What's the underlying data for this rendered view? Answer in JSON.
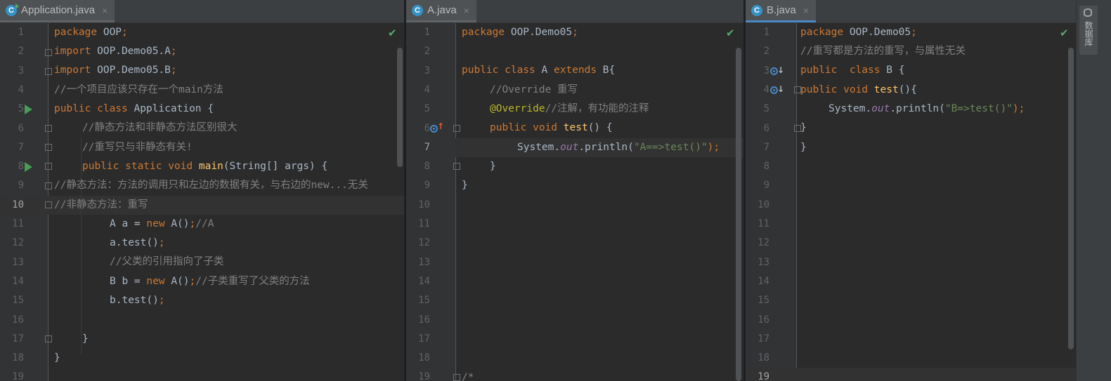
{
  "tabs": {
    "app": {
      "label": "Application.java",
      "close": "×"
    },
    "a": {
      "label": "A.java",
      "close": "×"
    },
    "b": {
      "label": "B.java",
      "close": "×"
    }
  },
  "file_icon_letter": "C",
  "right_strip": {
    "label": "数据库"
  },
  "status_check": "✔",
  "panes": {
    "app": {
      "line_numbers": [
        "1",
        "2",
        "3",
        "4",
        "5",
        "6",
        "7",
        "8",
        "9",
        "10",
        "11",
        "12",
        "13",
        "14",
        "15",
        "16",
        "17",
        "18",
        "19"
      ],
      "current_line": "10"
    },
    "a": {
      "line_numbers": [
        "1",
        "2",
        "3",
        "4",
        "5",
        "6",
        "7",
        "8",
        "9",
        "10",
        "11",
        "12",
        "13",
        "14",
        "15",
        "16",
        "17",
        "18",
        "19"
      ],
      "current_line": "7"
    },
    "b": {
      "line_numbers": [
        "1",
        "2",
        "3",
        "4",
        "5",
        "6",
        "7",
        "8",
        "9",
        "10",
        "11",
        "12",
        "13",
        "14",
        "15",
        "16",
        "17",
        "18",
        "19"
      ],
      "current_line": "19"
    }
  },
  "code_app": {
    "l1": {
      "kw": "package",
      "rest": " OOP",
      "semi": ";"
    },
    "l2": {
      "kw": "import",
      "rest": " OOP.Demo05.A",
      "semi": ";"
    },
    "l3": {
      "kw": "import",
      "rest": " OOP.Demo05.B",
      "semi": ";"
    },
    "l4": {
      "comment": "//一个项目应该只存在一个main方法"
    },
    "l5": {
      "kw": "public class",
      "rest": " Application {"
    },
    "l6": {
      "comment": "//静态方法和非静态方法区别很大"
    },
    "l7": {
      "comment": "//重写只与非静态有关!"
    },
    "l8": {
      "kw": "public static void",
      "fn": "main",
      "rest": "(String[] args) {"
    },
    "l9": {
      "comment": "//静态方法：方法的调用只和左边的数据有关，与右边的new...无关"
    },
    "l10": {
      "comment": "//非静态方法：重写"
    },
    "l11": {
      "pre": "A a = ",
      "kw": "new",
      "mid": " A()",
      "semi": ";",
      "comment": "//A"
    },
    "l12": {
      "pre": "a.test()",
      "semi": ";"
    },
    "l13": {
      "comment": "//父类的引用指向了子类"
    },
    "l14": {
      "pre": "B b = ",
      "kw": "new",
      "mid": " A()",
      "semi": ";",
      "comment": "//子类重写了父类的方法"
    },
    "l15": {
      "pre": "b.test()",
      "semi": ";"
    },
    "l17": {
      "rest": "}"
    },
    "l18": {
      "rest": "}"
    }
  },
  "code_a": {
    "l1": {
      "kw": "package",
      "rest": " OOP.Demo05",
      "semi": ";"
    },
    "l3": {
      "kw": "public class",
      "rest1": " A ",
      "kw2": "extends",
      "rest2": " B{"
    },
    "l4": {
      "comment": "//Override 重写"
    },
    "l5": {
      "ann": "@Override",
      "comment": "//注解，有功能的注释"
    },
    "l6": {
      "kw": "public void",
      "fn": "test",
      "rest": "() {"
    },
    "l7": {
      "pre": "System.",
      "static": "out",
      "mid": ".println(",
      "str": "\"A==>test()\"",
      "post": ");"
    },
    "l8": {
      "rest": "}"
    },
    "l9": {
      "rest": "}"
    },
    "l19": {
      "comment": "/*"
    }
  },
  "code_b": {
    "l1": {
      "kw": "package",
      "rest": " OOP.Demo05",
      "semi": ";"
    },
    "l2": {
      "comment": "//重写都是方法的重写，与属性无关"
    },
    "l3": {
      "kw": "public  class",
      "rest": " B {"
    },
    "l4": {
      "kw": "public void",
      "fn": "test",
      "rest": "(){"
    },
    "l5": {
      "pre": "System.",
      "static": "out",
      "mid": ".println(",
      "str": "\"B=>test()\"",
      "post": ");"
    },
    "l6": {
      "rest": "}"
    },
    "l7": {
      "rest": "}"
    }
  },
  "colors": {
    "background": "#2b2b2b",
    "keyword": "#cc7832",
    "comment": "#808080",
    "string": "#6a8759",
    "function": "#ffc66d",
    "annotation": "#bbb529",
    "static_field": "#9876aa",
    "run_gutter": "#499c54",
    "override_marker": "#4a88c7"
  }
}
